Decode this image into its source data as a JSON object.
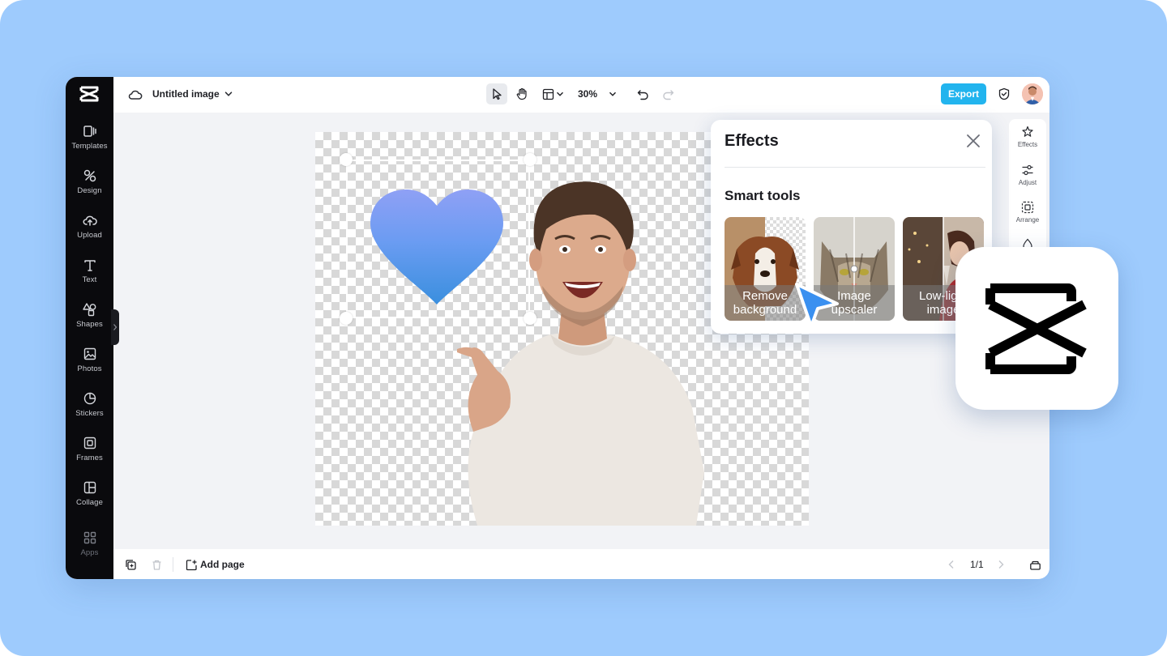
{
  "app": {
    "document_title": "Untitled image",
    "zoom": "30%",
    "export_label": "Export"
  },
  "sidebar": {
    "items": [
      {
        "label": "Templates",
        "icon": "templates-icon"
      },
      {
        "label": "Design",
        "icon": "design-icon"
      },
      {
        "label": "Upload",
        "icon": "upload-icon"
      },
      {
        "label": "Text",
        "icon": "text-icon"
      },
      {
        "label": "Shapes",
        "icon": "shapes-icon"
      },
      {
        "label": "Photos",
        "icon": "photos-icon"
      },
      {
        "label": "Stickers",
        "icon": "stickers-icon"
      },
      {
        "label": "Frames",
        "icon": "frames-icon"
      },
      {
        "label": "Collage",
        "icon": "collage-icon"
      },
      {
        "label": "Apps",
        "icon": "apps-icon"
      }
    ]
  },
  "right_tools": {
    "items": [
      {
        "label": "Effects",
        "icon": "effects-icon"
      },
      {
        "label": "Adjust",
        "icon": "adjust-icon"
      },
      {
        "label": "Arrange",
        "icon": "arrange-icon"
      }
    ]
  },
  "effects_panel": {
    "title": "Effects",
    "section_title": "Smart tools",
    "cards": [
      {
        "line1": "Remove",
        "line2": "background"
      },
      {
        "line1": "Image",
        "line2": "upscaler"
      },
      {
        "line1": "Low-light",
        "line2": "image"
      }
    ]
  },
  "bottom_bar": {
    "add_page_label": "Add page",
    "page_indicator": "1/1"
  },
  "colors": {
    "background": "#9ecbfd",
    "sidebar": "#0a0a0d",
    "accent": "#22b4ee",
    "heart_top": "#8fa0f5",
    "heart_bottom": "#3a8fde"
  }
}
